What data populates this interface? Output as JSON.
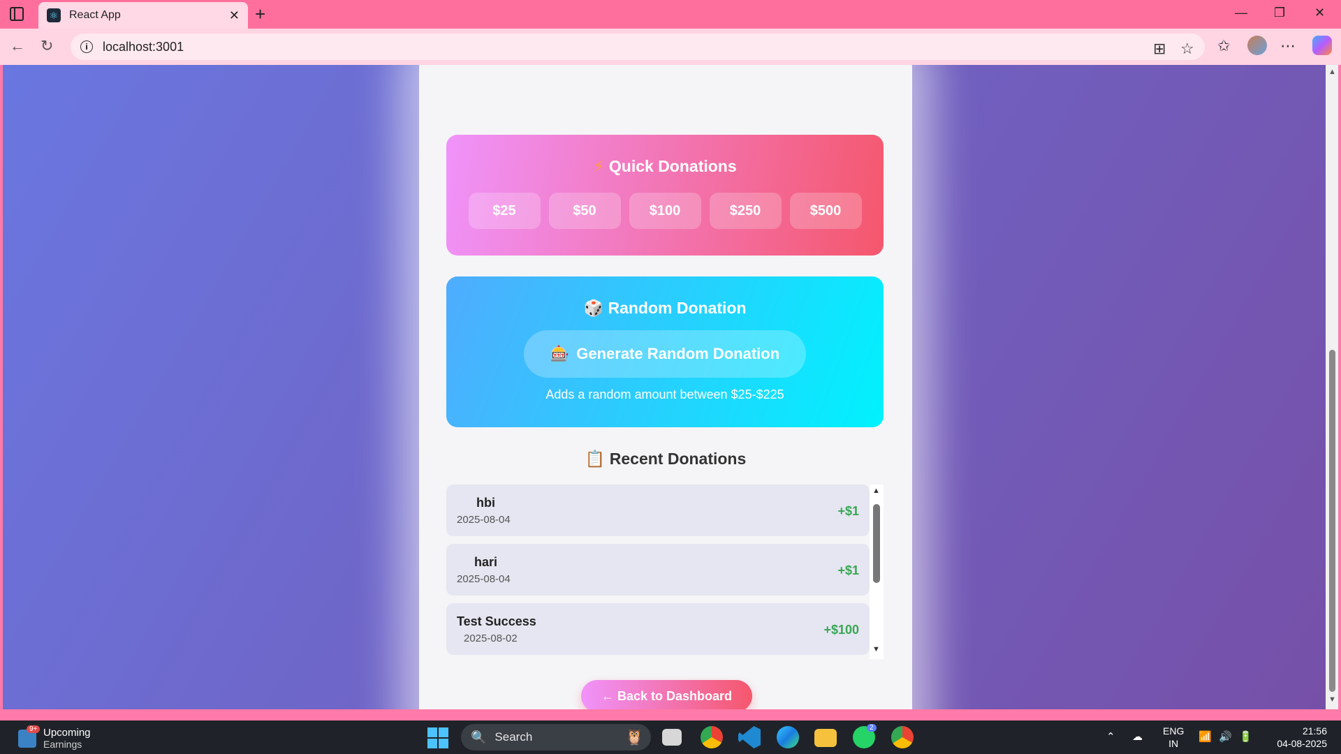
{
  "browser": {
    "tab_title": "React App",
    "url": "localhost:3001"
  },
  "quick_donations": {
    "icon": "lightning-icon",
    "title": "Quick Donations",
    "amounts": [
      "$25",
      "$50",
      "$100",
      "$250",
      "$500"
    ]
  },
  "random_donation": {
    "icon": "dice-icon",
    "title": "Random Donation",
    "button_icon": "slot-machine-icon",
    "button_label": "Generate Random Donation",
    "note": "Adds a random amount between $25-$225"
  },
  "recent_donations": {
    "icon": "clipboard-icon",
    "title": "Recent Donations",
    "items": [
      {
        "name": "hbi",
        "date": "2025-08-04",
        "amount": "+$1"
      },
      {
        "name": "hari",
        "date": "2025-08-04",
        "amount": "+$1"
      },
      {
        "name": "Test Success",
        "date": "2025-08-02",
        "amount": "+$100"
      }
    ]
  },
  "back_button": "← Back to Dashboard",
  "taskbar": {
    "widget_badge": "9+",
    "widget_title": "Upcoming",
    "widget_subtitle": "Earnings",
    "search_label": "Search",
    "whatsapp_badge": "2",
    "lang_1": "ENG",
    "lang_2": "IN",
    "time": "21:56",
    "date": "04-08-2025"
  },
  "colors": {
    "quick_gradient_start": "#f093fb",
    "quick_gradient_end": "#f5576c",
    "random_gradient_start": "#4facfe",
    "random_gradient_end": "#00f2fe",
    "amount_green": "#3aa655"
  }
}
